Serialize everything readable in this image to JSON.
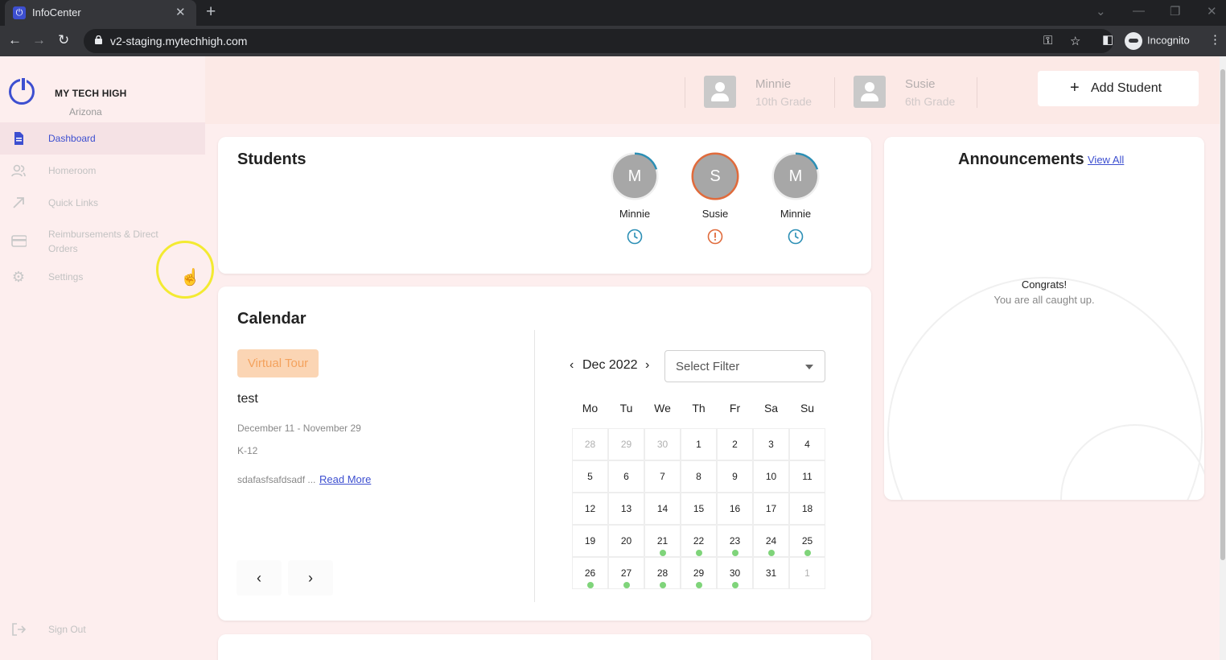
{
  "browser": {
    "tab_title": "InfoCenter",
    "tab_close": "✕",
    "new_tab": "+",
    "url": "v2-staging.mytechhigh.com",
    "profile": "Incognito"
  },
  "sidebar": {
    "brand": "MY TECH HIGH",
    "region": "Arizona",
    "items": [
      {
        "label": "Dashboard",
        "icon": "document-icon"
      },
      {
        "label": "Homeroom",
        "icon": "users-icon"
      },
      {
        "label": "Quick Links",
        "icon": "arrow-up-right-icon"
      },
      {
        "label": "Reimbursements & Direct Orders",
        "icon": "credit-card-icon"
      },
      {
        "label": "Settings",
        "icon": "gear-icon"
      }
    ],
    "sign_out": "Sign Out"
  },
  "header": {
    "students": [
      {
        "name": "Minnie",
        "grade": "10th Grade"
      },
      {
        "name": "Susie",
        "grade": "6th Grade"
      }
    ],
    "add_student": "Add Student"
  },
  "students_card": {
    "title": "Students",
    "students": [
      {
        "initial": "M",
        "name": "Minnie",
        "status": "clock",
        "progress": 0.2,
        "color": "#2c8fb5"
      },
      {
        "initial": "S",
        "name": "Susie",
        "status": "alert",
        "progress": 1.0,
        "color": "#e06b3c"
      },
      {
        "initial": "M",
        "name": "Minnie",
        "status": "clock",
        "progress": 0.2,
        "color": "#2c8fb5"
      }
    ]
  },
  "calendar": {
    "title": "Calendar",
    "event": {
      "tag": "Virtual Tour",
      "title": "test",
      "dates": "December 11 - November 29",
      "grades": "K-12",
      "excerpt": "sdafasfsafdsadf ...",
      "read_more": "Read More"
    },
    "prev": "‹",
    "next": "›",
    "month": "Dec 2022",
    "filter_placeholder": "Select Filter",
    "weekdays": [
      "Mo",
      "Tu",
      "We",
      "Th",
      "Fr",
      "Sa",
      "Su"
    ],
    "weeks": [
      [
        {
          "d": "28",
          "m": true
        },
        {
          "d": "29",
          "m": true
        },
        {
          "d": "30",
          "m": true
        },
        {
          "d": "1"
        },
        {
          "d": "2"
        },
        {
          "d": "3"
        },
        {
          "d": "4"
        }
      ],
      [
        {
          "d": "5"
        },
        {
          "d": "6"
        },
        {
          "d": "7"
        },
        {
          "d": "8"
        },
        {
          "d": "9"
        },
        {
          "d": "10"
        },
        {
          "d": "11"
        }
      ],
      [
        {
          "d": "12"
        },
        {
          "d": "13"
        },
        {
          "d": "14"
        },
        {
          "d": "15"
        },
        {
          "d": "16"
        },
        {
          "d": "17"
        },
        {
          "d": "18"
        }
      ],
      [
        {
          "d": "19"
        },
        {
          "d": "20"
        },
        {
          "d": "21",
          "e": true
        },
        {
          "d": "22",
          "e": true
        },
        {
          "d": "23",
          "e": true
        },
        {
          "d": "24",
          "e": true
        },
        {
          "d": "25",
          "e": true
        }
      ],
      [
        {
          "d": "26",
          "e": true
        },
        {
          "d": "27",
          "e": true
        },
        {
          "d": "28",
          "e": true
        },
        {
          "d": "29",
          "e": true
        },
        {
          "d": "30",
          "e": true
        },
        {
          "d": "31"
        },
        {
          "d": "1",
          "m": true
        }
      ]
    ]
  },
  "announcements": {
    "title": "Announcements",
    "view_all": "View All",
    "empty_title": "Congrats!",
    "empty_text": "You are all caught up."
  }
}
